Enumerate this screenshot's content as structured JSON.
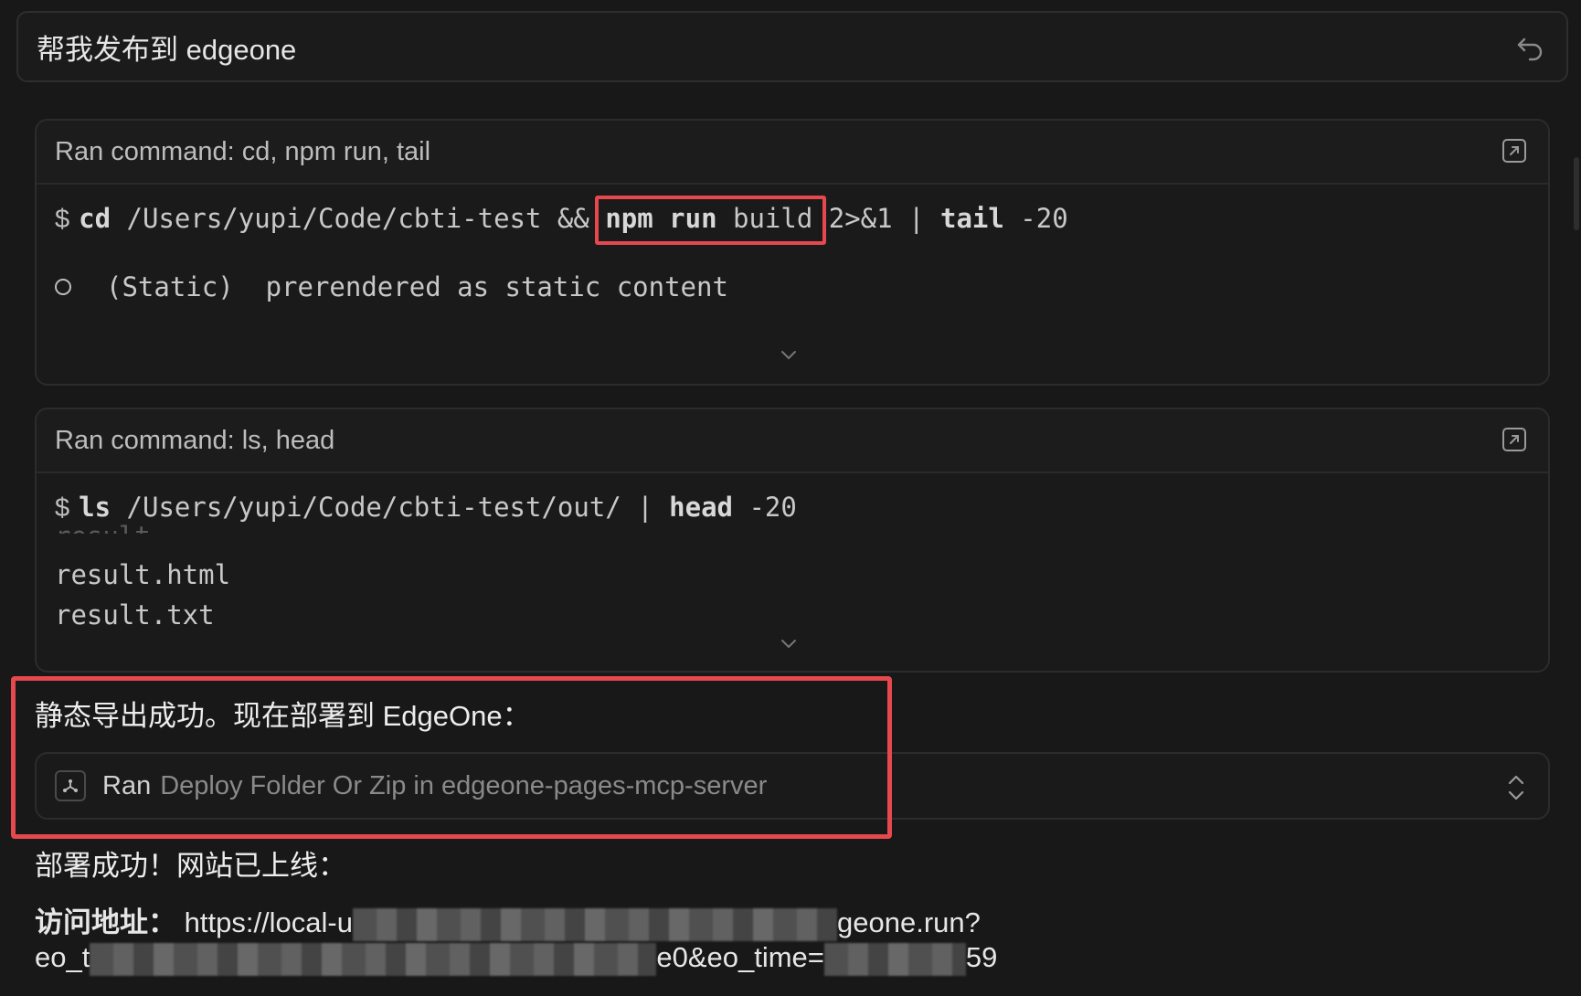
{
  "prompt": {
    "text": "帮我发布到 edgeone"
  },
  "cards": [
    {
      "header": "Ran command: cd, npm run, tail",
      "command": {
        "prompt_sign": "$",
        "kw_cd": "cd",
        "path": " /Users/yupi/Code/cbti-test && ",
        "kw_npm": "npm run",
        "build": " build",
        "redirect": " 2>&1 | ",
        "kw_tail": "tail",
        "arg": " -20"
      },
      "output": [
        "(Static)  prerendered as static content"
      ]
    },
    {
      "header": "Ran command: ls, head",
      "command": {
        "prompt_sign": "$",
        "kw_ls": "ls",
        "path": " /Users/yupi/Code/cbti-test/out/ | ",
        "kw_head": "head",
        "arg": " -20"
      },
      "output": [
        "result",
        "result.html",
        "result.txt"
      ]
    }
  ],
  "status": {
    "export_success": "静态导出成功。现在部署到 EdgeOne：",
    "deploy_ran": "Ran",
    "deploy_tool": "Deploy Folder Or Zip in edgeone-pages-mcp-server",
    "deploy_success": "部署成功！网站已上线：",
    "url_label": "访问地址：",
    "url_part1": "https://local-u",
    "url_part2": "geone.run?",
    "url_part3": "eo_t",
    "url_part4": "e0&eo_time=",
    "url_part5": "59"
  },
  "colors": {
    "highlight": "#e5484d",
    "background": "#181818"
  }
}
